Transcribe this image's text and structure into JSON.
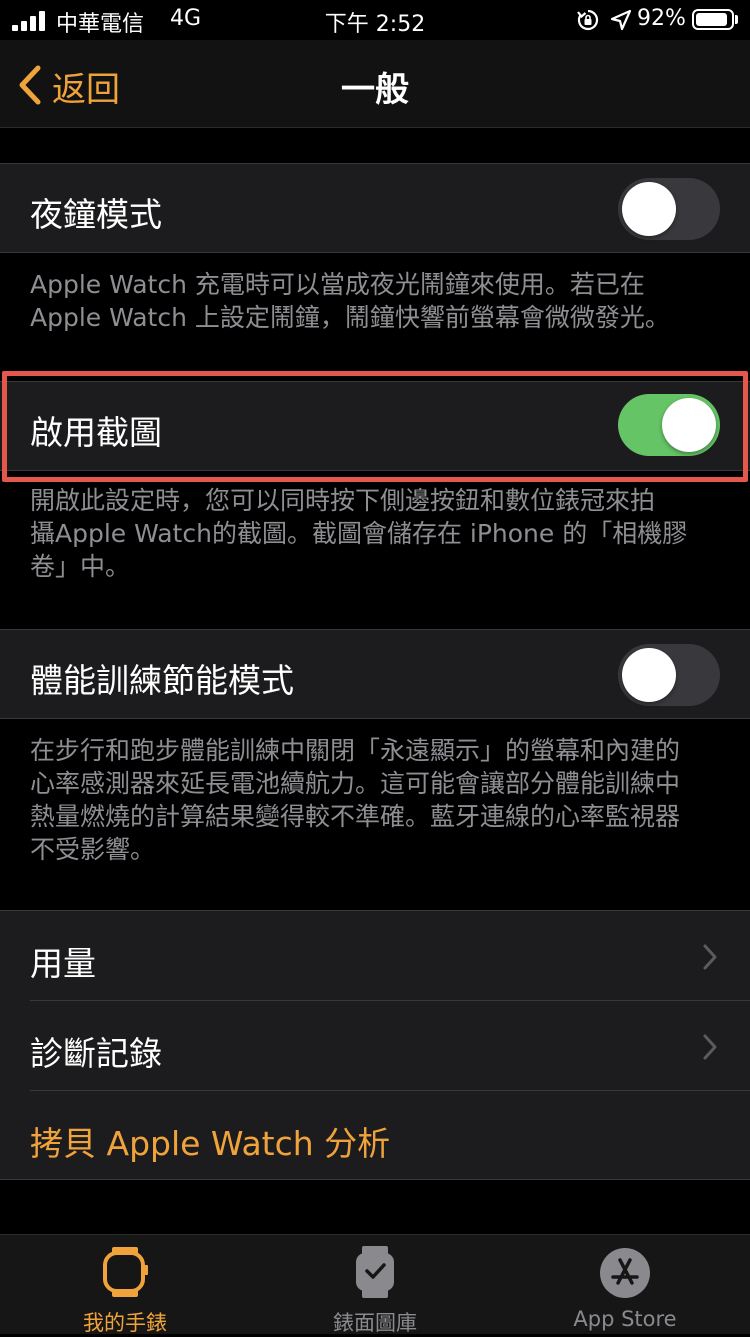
{
  "status_bar": {
    "carrier": "中華電信",
    "network": "4G",
    "time": "下午 2:52",
    "battery_percent": "92%",
    "battery_level": 0.92
  },
  "nav": {
    "back_label": "返回",
    "title": "一般"
  },
  "settings": {
    "night_mode": {
      "label": "夜鐘模式",
      "on": false,
      "footer": [
        "Apple Watch 充電時可以當成夜光鬧鐘來使用。若已在",
        "Apple Watch 上設定鬧鐘，鬧鐘快響前螢幕會微微發光。"
      ]
    },
    "screenshots": {
      "label": "啟用截圖",
      "on": true,
      "footer": [
        "開啟此設定時，您可以同時按下側邊按鈕和數位錶冠來拍",
        "攝Apple Watch的截圖。截圖會儲存在 iPhone 的「相機膠",
        "卷」中。"
      ]
    },
    "workout_power_saving": {
      "label": "體能訓練節能模式",
      "on": false,
      "footer": [
        "在步行和跑步體能訓練中關閉「永遠顯示」的螢幕和內建的",
        "心率感測器來延長電池續航力。這可能會讓部分體能訓練中",
        "熱量燃燒的計算結果變得較不準確。藍牙連線的心率監視器",
        "不受影響。"
      ]
    },
    "usage_label": "用量",
    "diagnostics_label": "診斷記錄",
    "copy_analytics_label": "拷貝 Apple Watch 分析"
  },
  "tabs": [
    {
      "label": "我的手錶",
      "icon": "watch-icon",
      "active": true
    },
    {
      "label": "錶面圖庫",
      "icon": "watch-face-icon",
      "active": false
    },
    {
      "label": "App Store",
      "icon": "app-store-icon",
      "active": false
    }
  ],
  "colors": {
    "accent": "#f0a33a",
    "toggle_on": "#65c466",
    "highlight": "#e4574d",
    "cell_bg": "#1c1c1e",
    "footer_text": "#8e8e93"
  }
}
